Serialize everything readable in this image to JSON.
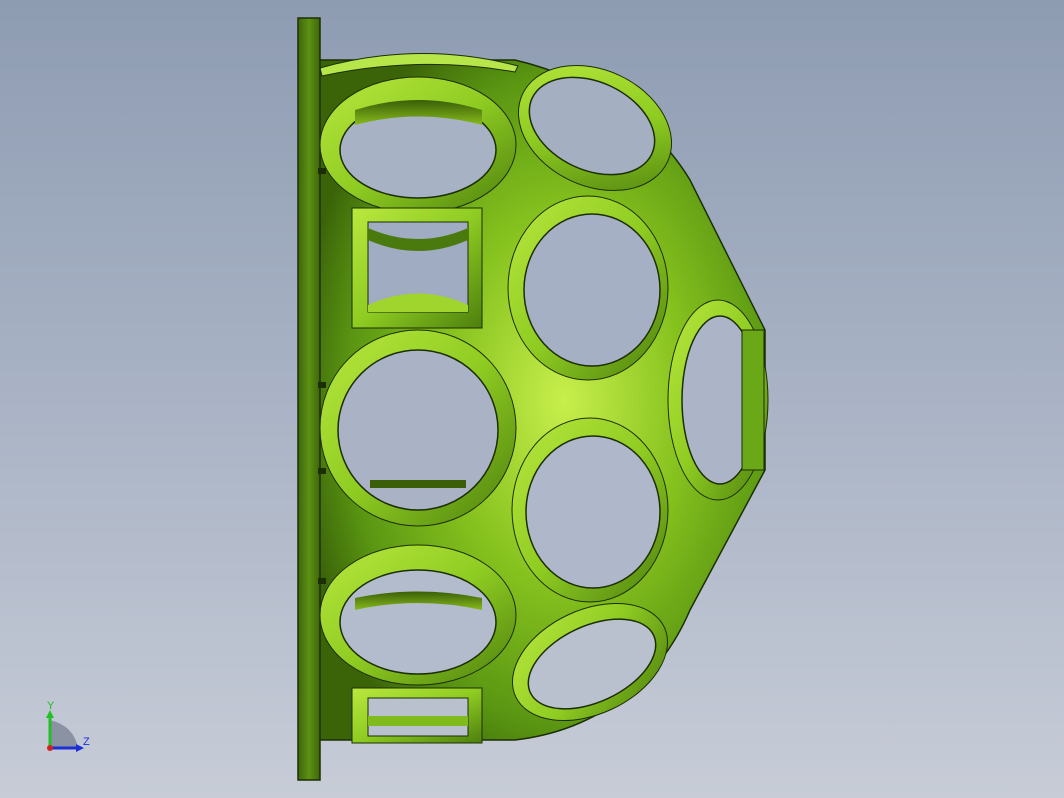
{
  "viewport": {
    "background_top": "#8e9cb2",
    "background_bottom": "#c7ccd7"
  },
  "model": {
    "part_color": "#5f9e12",
    "highlight_color": "#c6ee4a",
    "shadow_color": "#2f4d07",
    "outline_color": "#1c2e05"
  },
  "triad": {
    "y_label": "Y",
    "z_label": "Z",
    "y_color": "#22c022",
    "z_color": "#1a2fd6",
    "x_color": "#d62020"
  }
}
